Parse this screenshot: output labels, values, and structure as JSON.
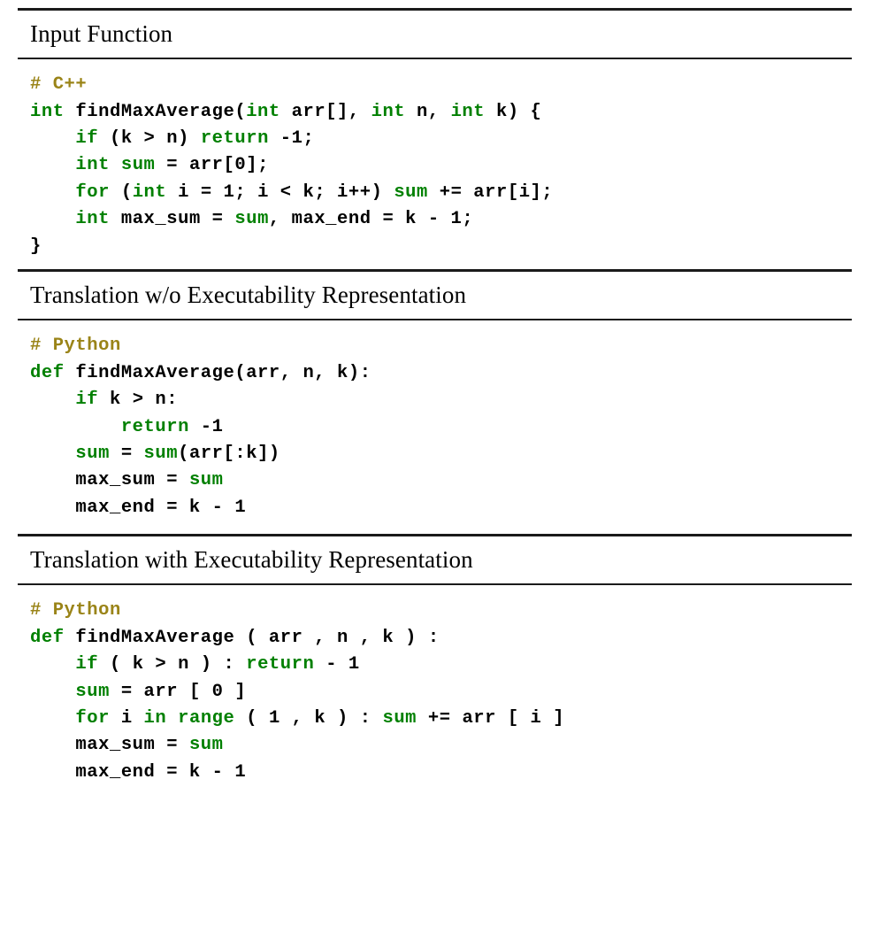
{
  "figure": {
    "kind": "code-translation-comparison",
    "accent_keyword_color": "#008000",
    "comment_color": "#9a8418",
    "text_color": "#000000",
    "rule_color": "#1a1a1a",
    "background_color": "#ffffff"
  },
  "sections": [
    {
      "title": "Input Function",
      "language_comment": "# C++",
      "lines": [
        [
          {
            "t": "# C++",
            "c": "cm"
          }
        ],
        [
          {
            "t": "int",
            "c": "kw"
          },
          {
            "t": " findMaxAverage(",
            "c": "pl"
          },
          {
            "t": "int",
            "c": "kw"
          },
          {
            "t": " arr[], ",
            "c": "pl"
          },
          {
            "t": "int",
            "c": "kw"
          },
          {
            "t": " n, ",
            "c": "pl"
          },
          {
            "t": "int",
            "c": "kw"
          },
          {
            "t": " k) {",
            "c": "pl"
          }
        ],
        [
          {
            "t": "    ",
            "c": "pl"
          },
          {
            "t": "if",
            "c": "kw"
          },
          {
            "t": " (k > n) ",
            "c": "pl"
          },
          {
            "t": "return",
            "c": "kw"
          },
          {
            "t": " -1;",
            "c": "pl"
          }
        ],
        [
          {
            "t": "    ",
            "c": "pl"
          },
          {
            "t": "int",
            "c": "kw"
          },
          {
            "t": " ",
            "c": "pl"
          },
          {
            "t": "sum",
            "c": "kw"
          },
          {
            "t": " = arr[0];",
            "c": "pl"
          }
        ],
        [
          {
            "t": "    ",
            "c": "pl"
          },
          {
            "t": "for",
            "c": "kw"
          },
          {
            "t": " (",
            "c": "pl"
          },
          {
            "t": "int",
            "c": "kw"
          },
          {
            "t": " i = 1; i < k; i++) ",
            "c": "pl"
          },
          {
            "t": "sum",
            "c": "kw"
          },
          {
            "t": " += arr[i];",
            "c": "pl"
          }
        ],
        [
          {
            "t": "    ",
            "c": "pl"
          },
          {
            "t": "int",
            "c": "kw"
          },
          {
            "t": " max_sum = ",
            "c": "pl"
          },
          {
            "t": "sum",
            "c": "kw"
          },
          {
            "t": ", max_end = k - 1;",
            "c": "pl"
          }
        ],
        [
          {
            "t": "}",
            "c": "pl"
          }
        ]
      ]
    },
    {
      "title": "Translation w/o Executability Representation",
      "language_comment": "# Python",
      "lines": [
        [
          {
            "t": "# Python",
            "c": "cm"
          }
        ],
        [
          {
            "t": "def",
            "c": "kw"
          },
          {
            "t": " findMaxAverage(arr, n, k):",
            "c": "pl"
          }
        ],
        [
          {
            "t": "    ",
            "c": "pl"
          },
          {
            "t": "if",
            "c": "kw"
          },
          {
            "t": " k > n:",
            "c": "pl"
          }
        ],
        [
          {
            "t": "        ",
            "c": "pl"
          },
          {
            "t": "return",
            "c": "kw"
          },
          {
            "t": " -1",
            "c": "pl"
          }
        ],
        [
          {
            "t": "    ",
            "c": "pl"
          },
          {
            "t": "sum",
            "c": "kw"
          },
          {
            "t": " = ",
            "c": "pl"
          },
          {
            "t": "sum",
            "c": "kw"
          },
          {
            "t": "(arr[:k])",
            "c": "pl"
          }
        ],
        [
          {
            "t": "    max_sum = ",
            "c": "pl"
          },
          {
            "t": "sum",
            "c": "kw"
          }
        ],
        [
          {
            "t": "    max_end = k - 1",
            "c": "pl"
          }
        ]
      ]
    },
    {
      "title": "Translation with Executability Representation",
      "language_comment": "# Python",
      "lines": [
        [
          {
            "t": "# Python",
            "c": "cm"
          }
        ],
        [
          {
            "t": "def",
            "c": "kw"
          },
          {
            "t": " findMaxAverage ( arr , n , k ) :",
            "c": "pl"
          }
        ],
        [
          {
            "t": "    ",
            "c": "pl"
          },
          {
            "t": "if",
            "c": "kw"
          },
          {
            "t": " ( k > n ) : ",
            "c": "pl"
          },
          {
            "t": "return",
            "c": "kw"
          },
          {
            "t": " - 1",
            "c": "pl"
          }
        ],
        [
          {
            "t": "    ",
            "c": "pl"
          },
          {
            "t": "sum",
            "c": "kw"
          },
          {
            "t": " = arr [ 0 ]",
            "c": "pl"
          }
        ],
        [
          {
            "t": "    ",
            "c": "pl"
          },
          {
            "t": "for",
            "c": "kw"
          },
          {
            "t": " i ",
            "c": "pl"
          },
          {
            "t": "in",
            "c": "kw"
          },
          {
            "t": " ",
            "c": "pl"
          },
          {
            "t": "range",
            "c": "kw"
          },
          {
            "t": " ( 1 , k ) : ",
            "c": "pl"
          },
          {
            "t": "sum",
            "c": "kw"
          },
          {
            "t": " += arr [ i ]",
            "c": "pl"
          }
        ],
        [
          {
            "t": "    max_sum = ",
            "c": "pl"
          },
          {
            "t": "sum",
            "c": "kw"
          }
        ],
        [
          {
            "t": "    max_end = k - 1",
            "c": "pl"
          }
        ]
      ]
    }
  ]
}
